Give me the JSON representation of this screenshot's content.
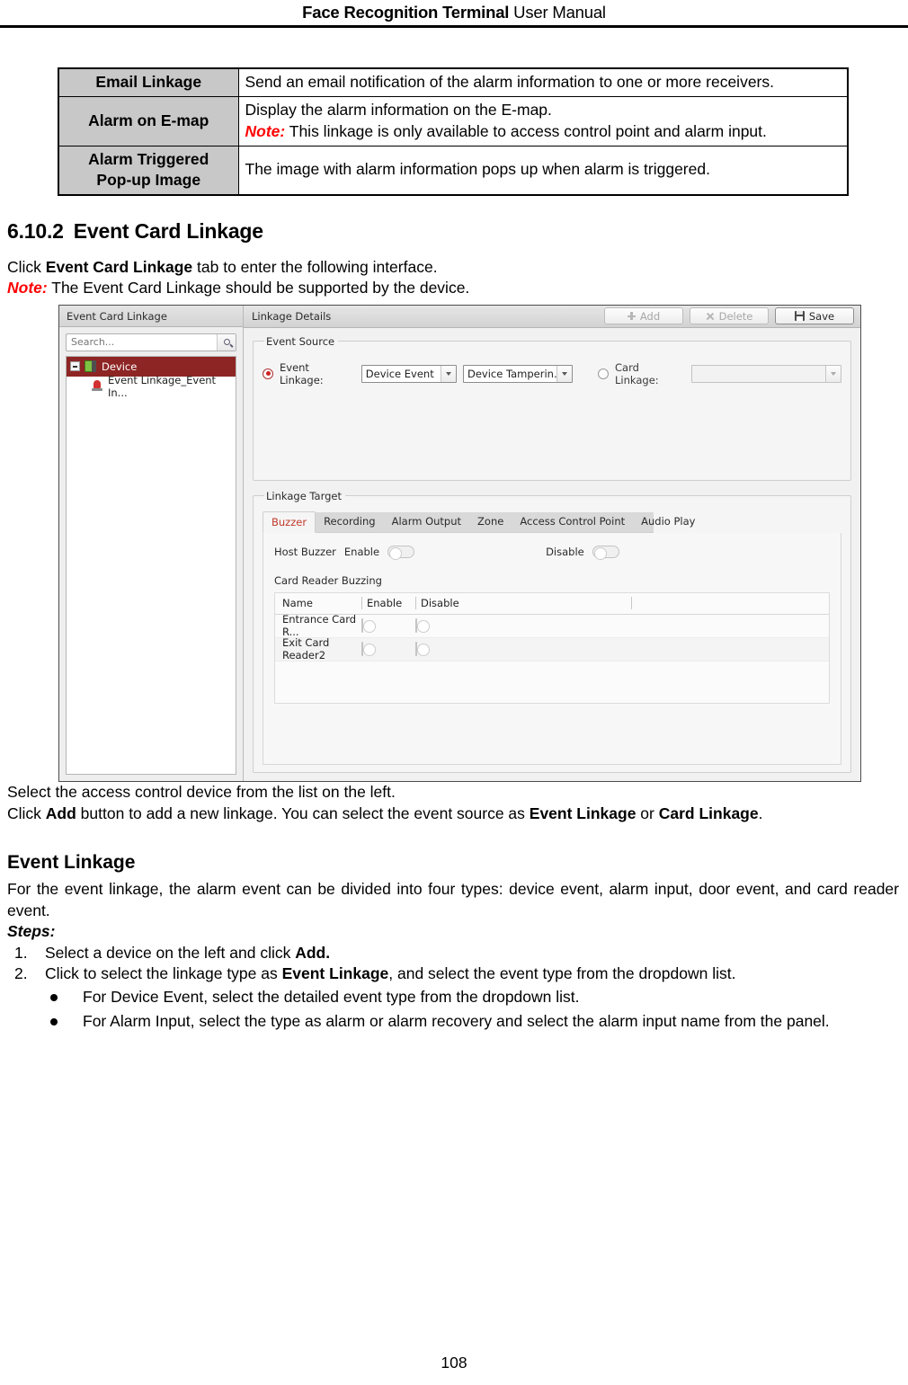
{
  "header": {
    "title_bold": "Face Recognition Terminal",
    "title_regular": " User Manual"
  },
  "table": {
    "rows": [
      {
        "label": "Email Linkage",
        "desc": "Send an email notification of the alarm information to one or more receivers.",
        "note_label": "",
        "note_text": ""
      },
      {
        "label": "Alarm on E-map",
        "desc": "Display the alarm information on the E-map.",
        "note_label": "Note:",
        "note_text": " This linkage is only available to access control point and alarm input."
      },
      {
        "label": "Alarm Triggered Pop-up Image",
        "label_line1": "Alarm Triggered",
        "label_line2": "Pop-up Image",
        "desc": "The image with alarm information pops up when alarm is triggered.",
        "note_label": "",
        "note_text": ""
      }
    ]
  },
  "section": {
    "number": "6.10.2",
    "title": "Event Card Linkage",
    "intro_pre": "Click ",
    "intro_bold": "Event Card Linkage",
    "intro_post": " tab to enter the following interface.",
    "note_label": "Note:",
    "note_text": " The Event Card Linkage should be supported by the device."
  },
  "screenshot": {
    "sidebar": {
      "title": "Event Card Linkage",
      "search_placeholder": "Search...",
      "search_value": "",
      "tree": [
        {
          "label": "Device",
          "selected": true
        },
        {
          "label": "Event Linkage_Event In...",
          "selected": false
        }
      ]
    },
    "toolbar": {
      "title": "Linkage Details",
      "add_label": "Add",
      "delete_label": "Delete",
      "save_label": "Save"
    },
    "event_source": {
      "legend": "Event Source",
      "event_linkage_label": "Event Linkage:",
      "event_linkage_selected": true,
      "dropdown1_value": "Device Event",
      "dropdown2_value": "Device Tamperin...",
      "card_linkage_label": "Card Linkage:",
      "card_linkage_selected": false,
      "card_dropdown_value": ""
    },
    "linkage_target": {
      "legend": "Linkage Target",
      "tabs": [
        {
          "label": "Buzzer",
          "active": true
        },
        {
          "label": "Recording",
          "active": false
        },
        {
          "label": "Alarm Output",
          "active": false
        },
        {
          "label": "Zone",
          "active": false
        },
        {
          "label": "Access Control Point",
          "active": false
        },
        {
          "label": "Audio Play",
          "active": false
        }
      ],
      "host_buzzer_label": "Host Buzzer",
      "enable_label": "Enable",
      "disable_label": "Disable",
      "card_reader_buzzing_title": "Card Reader Buzzing",
      "table_headers": {
        "name": "Name",
        "enable": "Enable",
        "disable": "Disable"
      },
      "table_rows": [
        {
          "name": "Entrance Card R...",
          "enable_on": false,
          "disable_on": false
        },
        {
          "name": "Exit Card Reader2",
          "enable_on": false,
          "disable_on": false
        }
      ]
    }
  },
  "body": {
    "line_select_device": "Select the access control device from the list on the left.",
    "click_add_pre": "Click ",
    "click_add_bold": "Add",
    "click_add_mid": " button to add a new linkage. You can select the event source as ",
    "click_add_bold2": "Event Linkage",
    "click_add_mid2": " or ",
    "click_add_bold3": "Card Linkage",
    "click_add_post": ".",
    "event_linkage_heading": "Event Linkage",
    "event_linkage_para": "For the event linkage, the alarm event can be divided into four types: device event, alarm input, door event, and card reader event.",
    "steps_label": "Steps:",
    "steps": [
      {
        "pre": "Select a device on the left and click ",
        "bold": "Add.",
        "post": ""
      },
      {
        "pre": "Click to select the linkage type as ",
        "bold": "Event Linkage",
        "post": ", and select the event type from the dropdown list."
      }
    ],
    "bullets": [
      "For Device Event, select the detailed event type from the dropdown list.",
      "For Alarm Input, select the type as alarm or alarm recovery and select the alarm input name from the panel."
    ]
  },
  "footer": {
    "page_number": "108"
  }
}
